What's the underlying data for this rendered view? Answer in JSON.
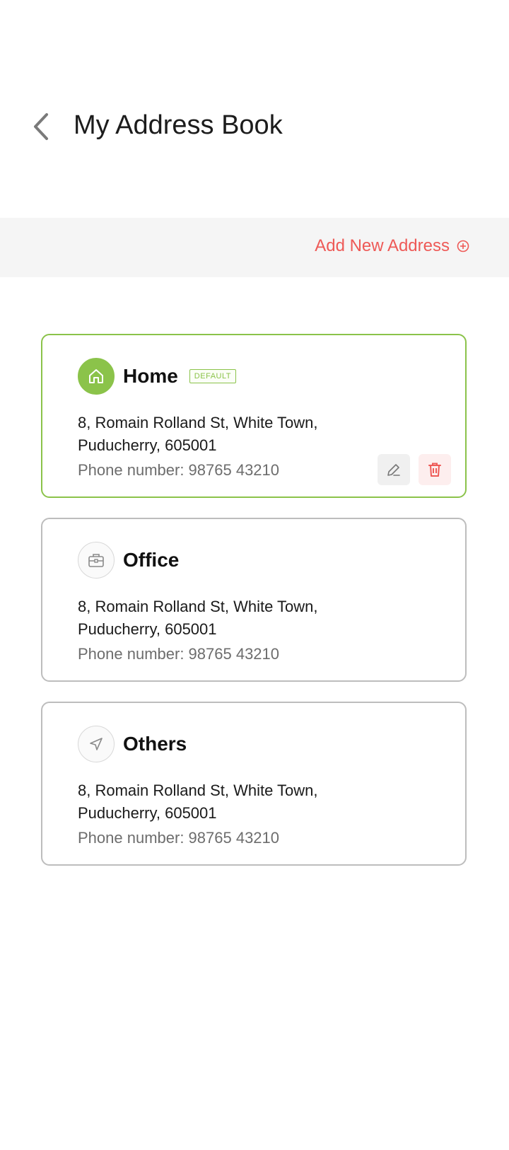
{
  "header": {
    "title": "My Address Book"
  },
  "add_bar": {
    "label": "Add New Address"
  },
  "addresses": [
    {
      "type": "Home",
      "badge": "DEFAULT",
      "line1": "8, Romain Rolland St, White Town,",
      "line2": "Puducherry, 605001",
      "phone": "Phone number: 98765 43210",
      "icon": "home-icon"
    },
    {
      "type": "Office",
      "line1": "8, Romain Rolland St, White Town,",
      "line2": "Puducherry, 605001",
      "phone": "Phone number: 98765 43210",
      "icon": "briefcase-icon"
    },
    {
      "type": "Others",
      "line1": "8, Romain Rolland St, White Town,",
      "line2": "Puducherry, 605001",
      "phone": "Phone number: 98765 43210",
      "icon": "navigation-arrow-icon"
    }
  ],
  "colors": {
    "accent_green": "#8bc34a",
    "accent_red": "#ee5a57",
    "border_gray": "#bdbdbd"
  }
}
